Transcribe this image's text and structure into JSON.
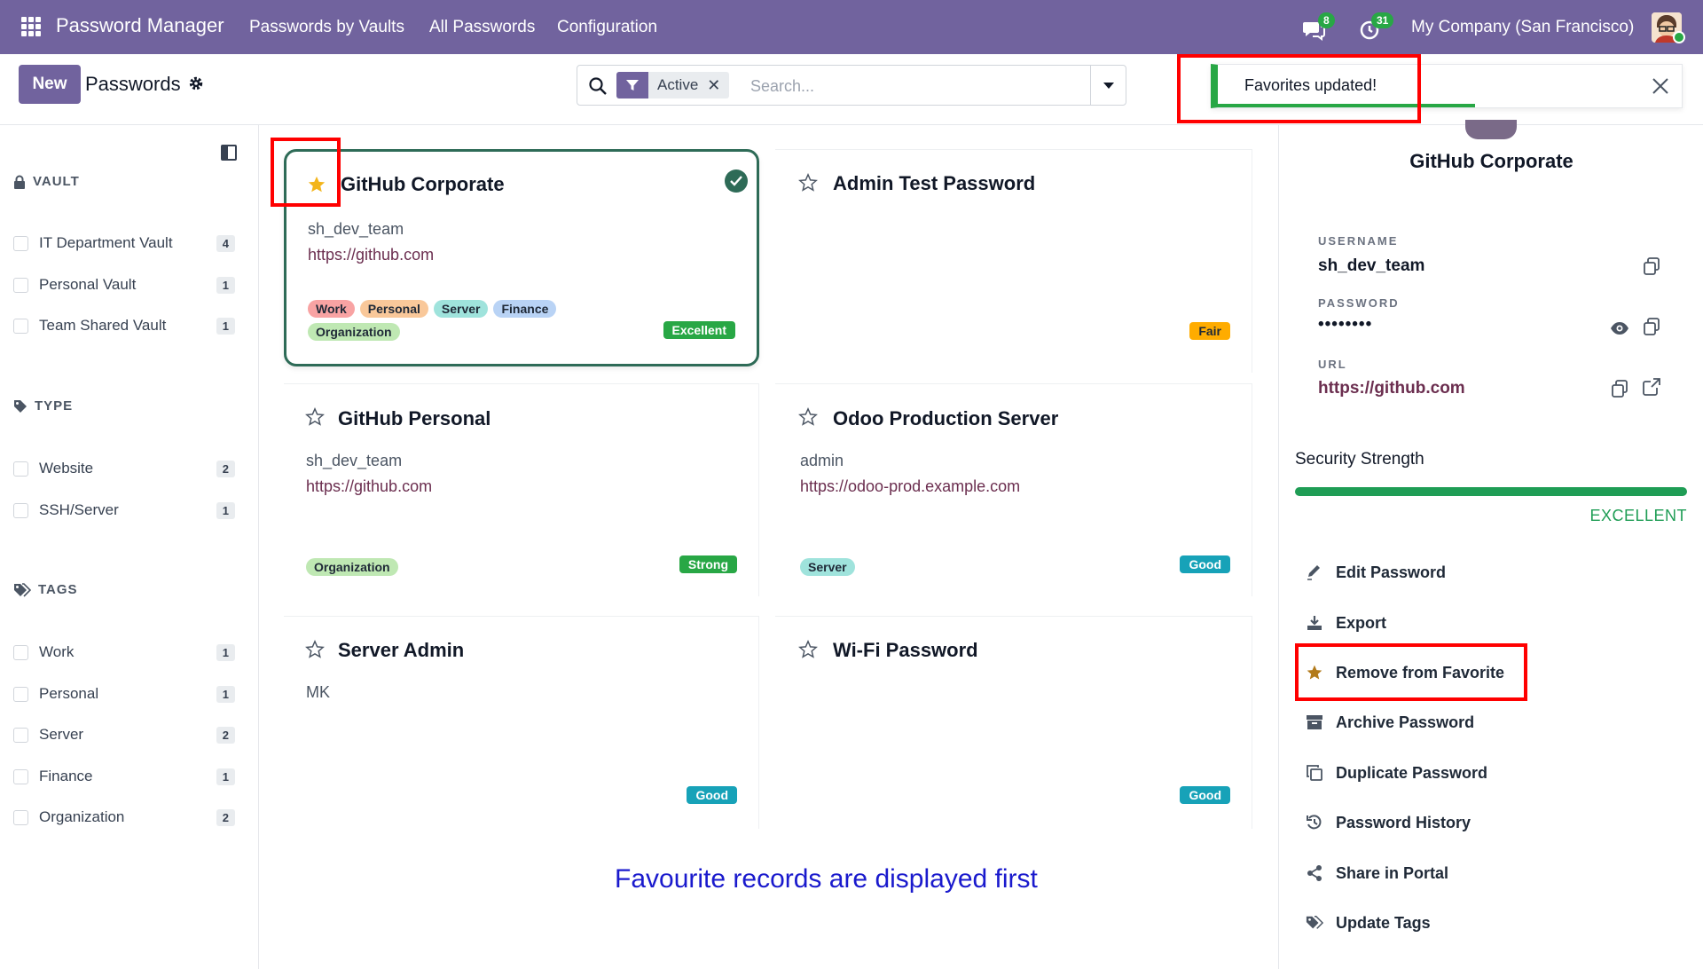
{
  "header": {
    "app_name": "Password Manager",
    "nav": [
      "Passwords by Vaults",
      "All Passwords",
      "Configuration"
    ],
    "chat_badge": "8",
    "activity_badge": "31",
    "company": "My Company (San Francisco)"
  },
  "control": {
    "new_label": "New",
    "title": "Passwords",
    "facet": "Active",
    "search_placeholder": "Search..."
  },
  "toast": {
    "message": "Favorites updated!"
  },
  "sidebar": {
    "vault": {
      "heading": "VAULT",
      "items": [
        {
          "label": "IT Department Vault",
          "count": "4"
        },
        {
          "label": "Personal Vault",
          "count": "1"
        },
        {
          "label": "Team Shared Vault",
          "count": "1"
        }
      ]
    },
    "type": {
      "heading": "TYPE",
      "items": [
        {
          "label": "Website",
          "count": "2"
        },
        {
          "label": "SSH/Server",
          "count": "1"
        }
      ]
    },
    "tags": {
      "heading": "TAGS",
      "items": [
        {
          "label": "Work",
          "count": "1"
        },
        {
          "label": "Personal",
          "count": "1"
        },
        {
          "label": "Server",
          "count": "2"
        },
        {
          "label": "Finance",
          "count": "1"
        },
        {
          "label": "Organization",
          "count": "2"
        }
      ]
    }
  },
  "cards": [
    {
      "title": "GitHub Corporate",
      "username": "sh_dev_team",
      "url": "https://github.com",
      "tags": [
        "Work",
        "Personal",
        "Server",
        "Finance",
        "Organization"
      ],
      "strength": "Excellent",
      "favorite": true
    },
    {
      "title": "Admin Test Password",
      "username": "",
      "url": "",
      "tags": [],
      "strength": "Fair",
      "favorite": false
    },
    {
      "title": "GitHub Personal",
      "username": "sh_dev_team",
      "url": "https://github.com",
      "tags": [
        "Organization"
      ],
      "strength": "Strong",
      "favorite": false
    },
    {
      "title": "Odoo Production Server",
      "username": "admin",
      "url": "https://odoo-prod.example.com",
      "tags": [
        "Server"
      ],
      "strength": "Good",
      "favorite": false
    },
    {
      "title": "Server Admin",
      "username": "MK",
      "url": "",
      "tags": [],
      "strength": "Good",
      "favorite": false
    },
    {
      "title": "Wi-Fi Password",
      "username": "",
      "url": "",
      "tags": [],
      "strength": "Good",
      "favorite": false
    }
  ],
  "colors": {
    "brand": "#71639e",
    "excellent": "#28a745",
    "strong": "#28a745",
    "good": "#17a2b8",
    "fair": "#ffac00",
    "tag_work": "#f8a3a3",
    "tag_personal": "#f9c89a",
    "tag_server": "#9fe3dc",
    "tag_finance": "#b9d3f5",
    "tag_organization": "#bfe8b3"
  },
  "note": "Favourite records are displayed first",
  "detail": {
    "title": "GitHub Corporate",
    "username_label": "USERNAME",
    "username": "sh_dev_team",
    "password_label": "PASSWORD",
    "password": "••••••••",
    "url_label": "URL",
    "url": "https://github.com",
    "security_label": "Security Strength",
    "security_level": "EXCELLENT",
    "security_fraction": 1.0,
    "actions": [
      "Edit Password",
      "Export",
      "Remove from Favorite",
      "Archive Password",
      "Duplicate Password",
      "Password History",
      "Share in Portal",
      "Update Tags"
    ]
  }
}
